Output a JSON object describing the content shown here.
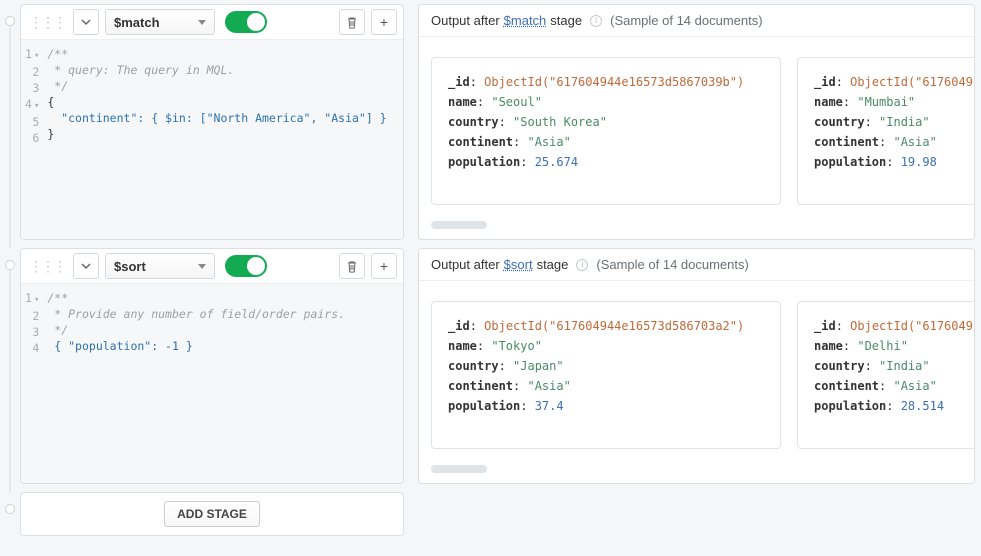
{
  "stages": [
    {
      "operator": "$match",
      "enabled": true,
      "code_lines": [
        {
          "n": 1,
          "fold": true,
          "type": "comment",
          "text": "/**"
        },
        {
          "n": 2,
          "fold": false,
          "type": "comment",
          "text": " * query: The query in MQL."
        },
        {
          "n": 3,
          "fold": false,
          "type": "comment",
          "text": " */"
        },
        {
          "n": 4,
          "fold": true,
          "type": "code",
          "text": "{"
        },
        {
          "n": 5,
          "fold": false,
          "type": "code",
          "text": "  \"continent\": { $in: [\"North America\", \"Asia\"] }"
        },
        {
          "n": 6,
          "fold": false,
          "type": "code",
          "text": "}"
        }
      ],
      "output_prefix": "Output after ",
      "output_suffix": " stage",
      "sample_text": "(Sample of 14 documents)",
      "documents": [
        {
          "_id": "ObjectId(\"617604944e16573d5867039b\")",
          "name": "\"Seoul\"",
          "country": "\"South Korea\"",
          "continent": "\"Asia\"",
          "population": "25.674"
        },
        {
          "_id": "ObjectId(\"6176049...\")",
          "name": "\"Mumbai\"",
          "country": "\"India\"",
          "continent": "\"Asia\"",
          "population": "19.98"
        }
      ]
    },
    {
      "operator": "$sort",
      "enabled": true,
      "code_lines": [
        {
          "n": 1,
          "fold": true,
          "type": "comment",
          "text": "/**"
        },
        {
          "n": 2,
          "fold": false,
          "type": "comment",
          "text": " * Provide any number of field/order pairs."
        },
        {
          "n": 3,
          "fold": false,
          "type": "comment",
          "text": " */"
        },
        {
          "n": 4,
          "fold": false,
          "type": "code",
          "text": " { \"population\": -1 }"
        }
      ],
      "output_prefix": "Output after ",
      "output_suffix": " stage",
      "sample_text": "(Sample of 14 documents)",
      "documents": [
        {
          "_id": "ObjectId(\"617604944e16573d586703a2\")",
          "name": "\"Tokyo\"",
          "country": "\"Japan\"",
          "continent": "\"Asia\"",
          "population": "37.4"
        },
        {
          "_id": "ObjectId(\"6176049...\")",
          "name": "\"Delhi\"",
          "country": "\"India\"",
          "continent": "\"Asia\"",
          "population": "28.514"
        }
      ]
    }
  ],
  "field_labels": {
    "_id": "_id",
    "name": "name",
    "country": "country",
    "continent": "continent",
    "population": "population"
  },
  "add_stage_label": "ADD STAGE"
}
